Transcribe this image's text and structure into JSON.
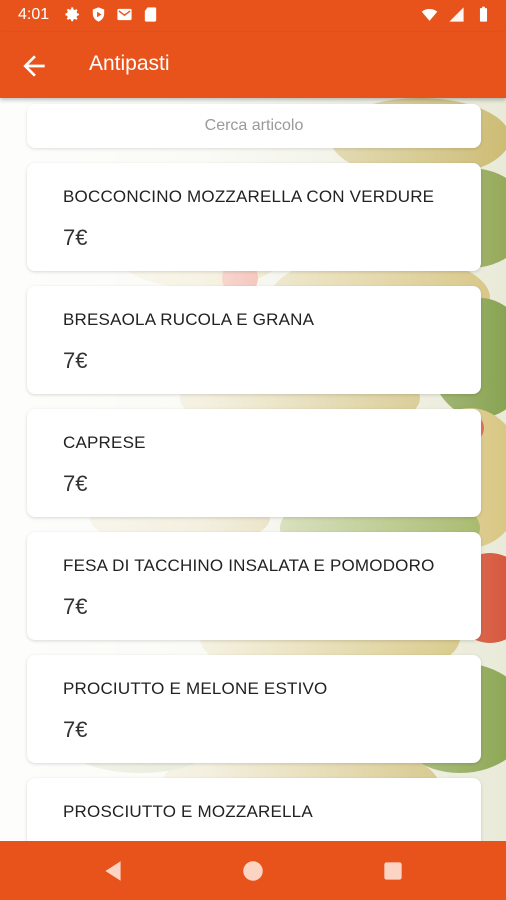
{
  "status_bar": {
    "time": "4:01",
    "left_icons": [
      "gear-icon",
      "shield-icon",
      "mail-icon",
      "sd-card-icon"
    ],
    "right_icons": [
      "wifi-icon",
      "signal-icon",
      "battery-icon"
    ]
  },
  "app_bar": {
    "title": "Antipasti",
    "back_icon": "arrow-left-icon",
    "color": "#e8531c"
  },
  "search": {
    "placeholder": "Cerca articolo"
  },
  "items": [
    {
      "name": "BOCCONCINO MOZZARELLA CON VERDURE",
      "price": "7€"
    },
    {
      "name": "BRESAOLA RUCOLA E GRANA",
      "price": "7€"
    },
    {
      "name": "CAPRESE",
      "price": "7€"
    },
    {
      "name": "FESA DI TACCHINO INSALATA E POMODORO",
      "price": "7€"
    },
    {
      "name": "PROCIUTTO E MELONE ESTIVO",
      "price": "7€"
    },
    {
      "name": "PROSCIUTTO E MOZZARELLA",
      "price": ""
    }
  ],
  "nav_bar": {
    "buttons": [
      "back-triangle-icon",
      "home-circle-icon",
      "recents-square-icon"
    ]
  }
}
